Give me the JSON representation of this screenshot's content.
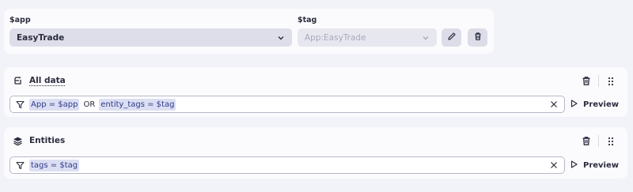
{
  "variables": {
    "app": {
      "label": "$app",
      "value": "EasyTrade"
    },
    "tag": {
      "label": "$tag",
      "value": "App:EasyTrade"
    }
  },
  "sections": [
    {
      "title": "All data",
      "icon": "data-source-icon",
      "filter": {
        "tokens": [
          "App = $app",
          "OR",
          "entity_tags = $tag"
        ]
      },
      "preview_label": "Preview"
    },
    {
      "title": "Entities",
      "icon": "layers-icon",
      "filter": {
        "tokens": [
          "tags = $tag"
        ]
      },
      "preview_label": "Preview"
    }
  ],
  "colors": {
    "accent_token_bg": "#dcdff3",
    "accent_token_fg": "#2f3a8a",
    "card_bg": "#fbfbfd",
    "page_bg": "#f2f3f8"
  }
}
